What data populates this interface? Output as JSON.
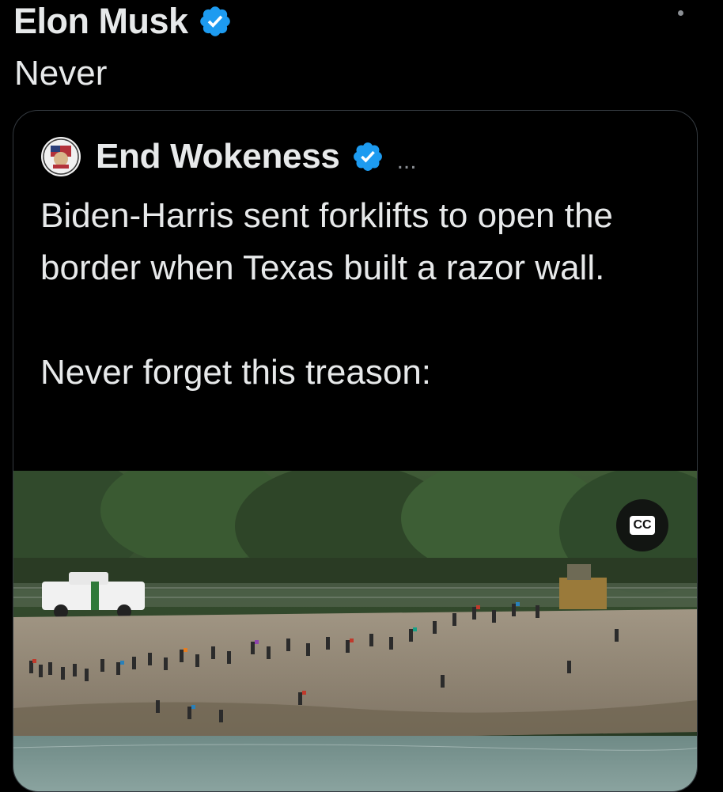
{
  "post": {
    "author_name": "Elon Musk",
    "text": "Never"
  },
  "quoted_post": {
    "author_name": "End Wokeness",
    "ellipsis": "...",
    "text_lines": [
      "Biden-Harris sent forklifts to open the border when Texas built a razor wall.",
      "Never forget this treason:"
    ]
  },
  "video": {
    "cc_label": "CC"
  },
  "colors": {
    "background": "#000000",
    "text": "#e7e9ea",
    "verified_blue": "#1d9bf0",
    "card_border": "#343a40"
  },
  "icons": {
    "verified": "verified-badge-icon",
    "more": "more-options-icon",
    "captions": "closed-captions-icon"
  }
}
